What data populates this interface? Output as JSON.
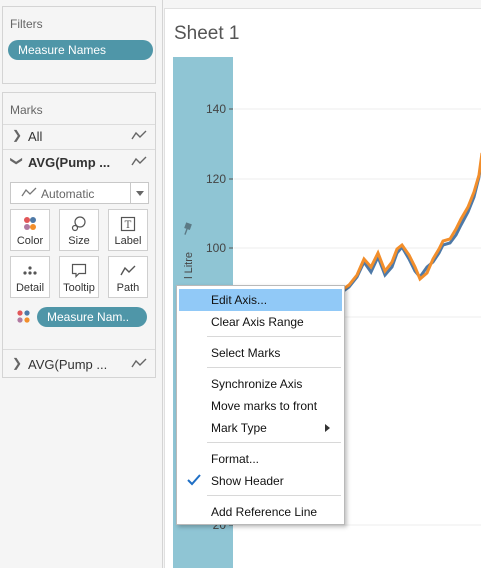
{
  "filters": {
    "title": "Filters",
    "pill": "Measure Names"
  },
  "marks": {
    "title": "Marks",
    "all_label": "All",
    "active_card": "AVG(Pump ...",
    "mark_type": "Automatic",
    "buttons": {
      "color": "Color",
      "size": "Size",
      "label": "Label",
      "detail": "Detail",
      "tooltip": "Tooltip",
      "path": "Path"
    },
    "detail_pill": "Measure Nam..",
    "collapsed_card": "AVG(Pump ..."
  },
  "sheet": {
    "title": "Sheet 1",
    "axis_title_fragment": "l Litre",
    "y_ticks": [
      "140",
      "120",
      "100",
      "20"
    ]
  },
  "context_menu": {
    "items": [
      {
        "label": "Edit Axis...",
        "highlighted": true
      },
      {
        "label": "Clear Axis Range"
      },
      {
        "label": "Select Marks"
      },
      {
        "label": "Synchronize Axis"
      },
      {
        "label": "Move marks to front"
      },
      {
        "label": "Mark Type",
        "submenu": true
      },
      {
        "label": "Format..."
      },
      {
        "label": "Show Header",
        "checked": true
      },
      {
        "label": "Add Reference Line"
      }
    ]
  },
  "colors": {
    "pill": "#4f96a8",
    "axis_band": "#8fc5d4",
    "series_blue": "#4e79a7",
    "series_orange": "#f28e2b",
    "menu_highlight": "#91c9f7"
  }
}
